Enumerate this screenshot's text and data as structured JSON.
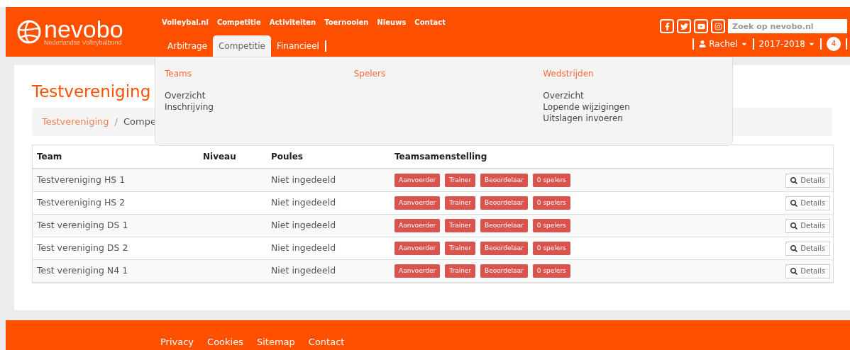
{
  "logo": {
    "name": "nevobo",
    "subtitle": "Nederlandse Volleybalbond"
  },
  "top_nav": [
    {
      "label": "Volleybal.nl"
    },
    {
      "label": "Competitie"
    },
    {
      "label": "Activiteiten"
    },
    {
      "label": "Toernooien"
    },
    {
      "label": "Nieuws"
    },
    {
      "label": "Contact"
    }
  ],
  "sub_nav": [
    {
      "label": "Arbitrage",
      "selected": false
    },
    {
      "label": "Competitie",
      "selected": true
    },
    {
      "label": "Financieel",
      "selected": false
    }
  ],
  "search": {
    "placeholder": "Zoek op nevobo.nl"
  },
  "user_menu": {
    "user": "Rachel",
    "season": "2017-2018",
    "notifications": "4"
  },
  "dropdown": {
    "columns": [
      {
        "heading": "Teams",
        "links": [
          "Overzicht",
          "Inschrijving"
        ]
      },
      {
        "heading": "Spelers"
      },
      {
        "heading": "Wedstrijden",
        "links": [
          "Overzicht",
          "Lopende wijzigingen",
          "Uitslagen invoeren"
        ]
      }
    ]
  },
  "page_title": "Testvereniging",
  "breadcrumb": {
    "separator": "/",
    "items": [
      "Testvereniging",
      "Compe"
    ]
  },
  "table": {
    "columns": [
      "Team",
      "Niveau",
      "Poules",
      "Teamsamenstelling"
    ],
    "rows": [
      {
        "team": "Testvereniging HS 1",
        "poule": "Niet ingedeeld",
        "tags": [
          "Aanvoerder",
          "Trainer",
          "Beoordelaar",
          "0 spelers"
        ],
        "action": "Details"
      },
      {
        "team": "Testvereniging HS 2",
        "poule": "Niet ingedeeld",
        "tags": [
          "Aanvoerder",
          "Trainer",
          "Beoordelaar",
          "0 spelers"
        ],
        "action": "Details"
      },
      {
        "team": "Test vereniging DS 1",
        "poule": "Niet ingedeeld",
        "tags": [
          "Aanvoerder",
          "Trainer",
          "Beoordelaar",
          "0 spelers"
        ],
        "action": "Details"
      },
      {
        "team": "Test vereniging DS 2",
        "poule": "Niet ingedeeld",
        "tags": [
          "Aanvoerder",
          "Trainer",
          "Beoordelaar",
          "0 spelers"
        ],
        "action": "Details"
      },
      {
        "team": "Test vereniging N4 1",
        "poule": "Niet ingedeeld",
        "tags": [
          "Aanvoerder",
          "Trainer",
          "Beoordelaar",
          "0 spelers"
        ],
        "action": "Details"
      }
    ]
  },
  "footer_links": [
    "Privacy",
    "Cookies",
    "Sitemap",
    "Contact"
  ]
}
